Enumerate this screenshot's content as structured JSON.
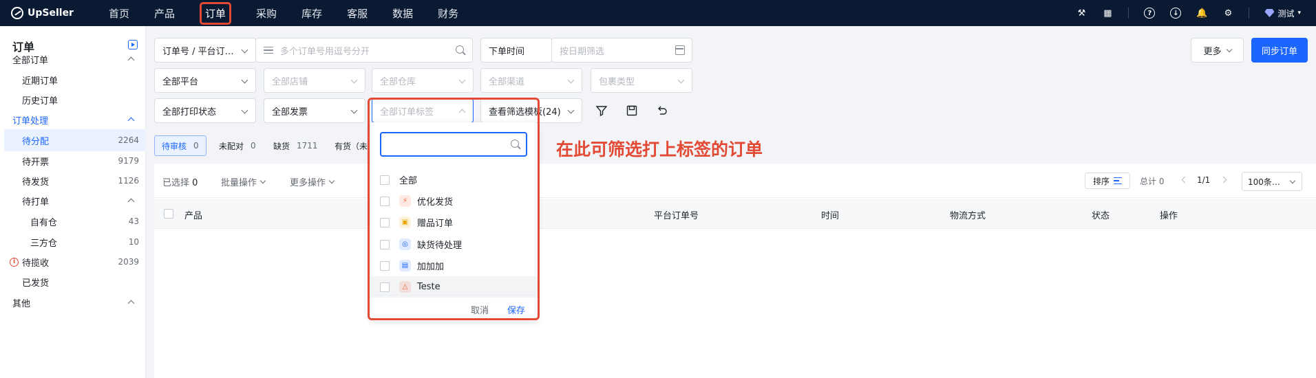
{
  "app": {
    "logo_text": "UpSeller",
    "nav": [
      "首页",
      "产品",
      "订单",
      "采购",
      "库存",
      "客服",
      "数据",
      "财务"
    ],
    "active_nav": "订单",
    "user_label": "测试"
  },
  "sidebar": {
    "title": "订单",
    "rows": [
      {
        "label": "全部订单",
        "count": "",
        "type": "group"
      },
      {
        "label": "近期订单",
        "count": "",
        "type": "sub"
      },
      {
        "label": "历史订单",
        "count": "",
        "type": "sub"
      },
      {
        "label": "订单处理",
        "count": "",
        "type": "group blue"
      },
      {
        "label": "待分配",
        "count": "2264",
        "type": "sel"
      },
      {
        "label": "待开票",
        "count": "9179",
        "type": "sub"
      },
      {
        "label": "待发货",
        "count": "1126",
        "type": "sub"
      },
      {
        "label": "待打单",
        "count": "",
        "type": "sub"
      },
      {
        "label": "自有仓",
        "count": "43",
        "type": "sub2"
      },
      {
        "label": "三方仓",
        "count": "10",
        "type": "sub2"
      },
      {
        "label": "待揽收",
        "count": "2039",
        "type": "sub warn"
      },
      {
        "label": "已发货",
        "count": "",
        "type": "sub"
      },
      {
        "label": "其他",
        "count": "",
        "type": "group"
      }
    ]
  },
  "filters": {
    "order_no_type": "订单号 / 平台订…",
    "order_no_placeholder": "多个订单号用逗号分开",
    "time_type": "下单时间",
    "date_placeholder": "按日期筛选",
    "platform": "全部平台",
    "store": "全部店铺",
    "warehouse": "全部仓库",
    "channel": "全部渠道",
    "package_type": "包裹类型",
    "print_status": "全部打印状态",
    "invoice": "全部发票",
    "order_tags": "全部订单标签",
    "templates": "查看筛选模板(24)",
    "more": "更多",
    "sync": "同步订单"
  },
  "status_tabs": [
    {
      "label": "待审核",
      "count": "0"
    },
    {
      "label": "未配对",
      "count": "0"
    },
    {
      "label": "缺货",
      "count": "1711"
    },
    {
      "label": "有货（未",
      "count": ""
    }
  ],
  "toolbar": {
    "selected_label": "已选择",
    "selected_count": "0",
    "batch": "批量操作",
    "more_ops": "更多操作",
    "sort": "排序",
    "total": "总计 0",
    "page": "1/1",
    "page_size": "100条…"
  },
  "table_headers": [
    "产品",
    "平台订单号",
    "时间",
    "物流方式",
    "状态",
    "操作"
  ],
  "tag_dropdown": {
    "search_value": "",
    "options": [
      {
        "label": "全部",
        "icon": "",
        "color": ""
      },
      {
        "label": "优化发货",
        "icon": "lightning-icon",
        "color": "#f25c2a"
      },
      {
        "label": "赠品订单",
        "icon": "gift-icon",
        "color": "#e8a700"
      },
      {
        "label": "缺货待处理",
        "icon": "pin-icon",
        "color": "#1a66ff"
      },
      {
        "label": "加加加",
        "icon": "box-icon",
        "color": "#1a66ff"
      },
      {
        "label": "Teste",
        "icon": "flame-icon",
        "color": "#f25c2a"
      }
    ],
    "cancel": "取消",
    "save": "保存"
  },
  "annotation": "在此可筛选打上标签的订单",
  "colors": {
    "primary": "#1a66ff",
    "nav_bg": "#0b1a33",
    "annotation": "#e24a35"
  }
}
